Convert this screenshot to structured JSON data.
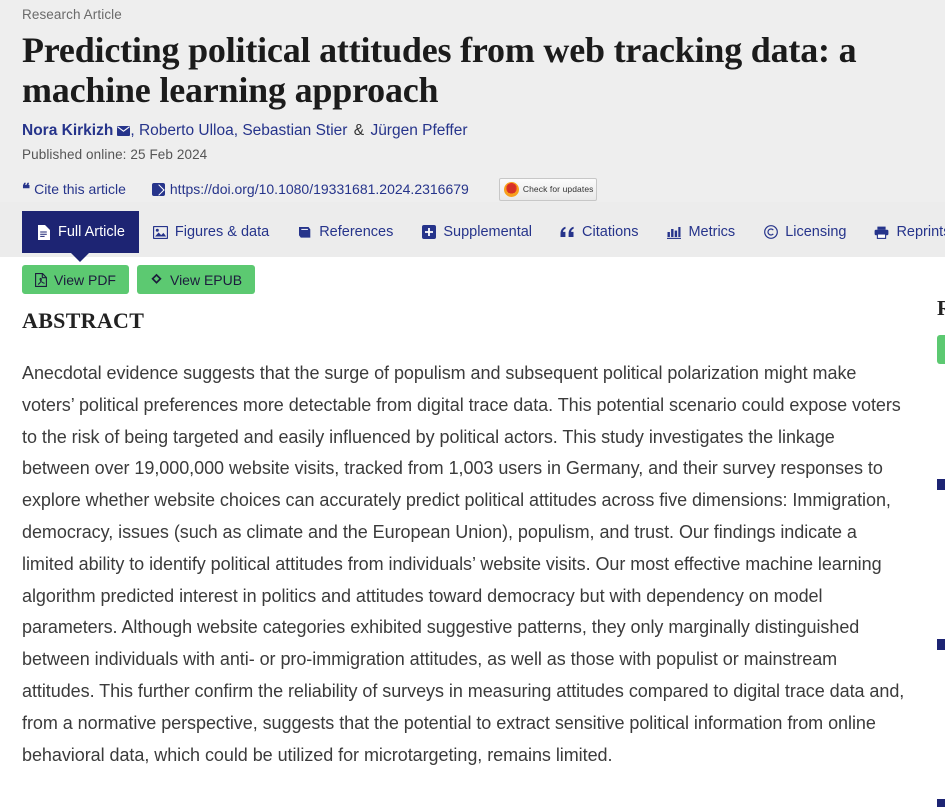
{
  "header": {
    "kicker": "Research Article",
    "title": "Predicting political attitudes from web tracking data: a machine learning approach",
    "authors": [
      {
        "name": "Nora Kirkizh",
        "first": true,
        "has_email_icon": true
      },
      {
        "name": "Roberto Ulloa",
        "first": false,
        "has_email_icon": false
      },
      {
        "name": "Sebastian Stier",
        "first": false,
        "has_email_icon": false
      },
      {
        "name": "Jürgen Pfeffer",
        "first": false,
        "has_email_icon": false
      }
    ],
    "author_separator": ",",
    "author_conjunction": "&",
    "published": "Published online: 25 Feb 2024",
    "cite_label": "Cite this article",
    "doi_url": "https://doi.org/10.1080/19331681.2024.2316679",
    "crossmark_label": "Check for updates"
  },
  "tabs": [
    {
      "label": "Full Article",
      "icon": "document-icon",
      "active": true
    },
    {
      "label": "Figures & data",
      "icon": "image-icon",
      "active": false
    },
    {
      "label": "References",
      "icon": "book-icon",
      "active": false
    },
    {
      "label": "Supplemental",
      "icon": "plus-square-icon",
      "active": false
    },
    {
      "label": "Citations",
      "icon": "quote-icon",
      "active": false
    },
    {
      "label": "Metrics",
      "icon": "bar-chart-icon",
      "active": false
    },
    {
      "label": "Licensing",
      "icon": "copyright-icon",
      "active": false
    },
    {
      "label": "Reprints &",
      "icon": "printer-icon",
      "active": false
    }
  ],
  "actions": [
    {
      "label": "View PDF",
      "icon": "pdf-file-icon"
    },
    {
      "label": "View EPUB",
      "icon": "epub-icon"
    }
  ],
  "main": {
    "abstract_heading": "ABSTRACT",
    "abstract_text": "Anecdotal evidence suggests that the surge of populism and subsequent political polarization might make voters’ political preferences more detectable from digital trace data. This potential scenario could expose voters to the risk of being targeted and easily influenced by political actors. This study investigates the linkage between over 19,000,000 website visits, tracked from 1,003 users in Germany, and their survey responses to explore whether website choices can accurately predict political attitudes across five dimensions: Immigration, democracy, issues (such as climate and the European Union), populism, and trust. Our findings indicate a limited ability to identify political attitudes from individuals’ website visits. Our most effective machine learning algorithm predicted interest in politics and attitudes toward democracy but with dependency on model parameters. Although website categories exhibited suggestive patterns, they only marginally distinguished between individuals with anti- or pro-immigration attitudes, as well as those with populist or mainstream attitudes. This further confirm the reliability of surveys in measuring attitudes compared to digital trace data and, from a normative perspective, suggests that the potential to extract sensitive political information from online behavioral data, which could be utilized for microtargeting, remains limited."
  },
  "sidebar": {
    "title": "R",
    "button_label": "",
    "items": [
      {
        "label": ""
      },
      {
        "label": ""
      },
      {
        "label": ""
      }
    ]
  },
  "colors": {
    "brand_navy": "#1d2473",
    "link_blue": "#26348b",
    "accent_green": "#5cc971",
    "header_bg": "#eeeeee",
    "tabbar_bg": "#ececec",
    "body_text": "#3b3b3b"
  }
}
